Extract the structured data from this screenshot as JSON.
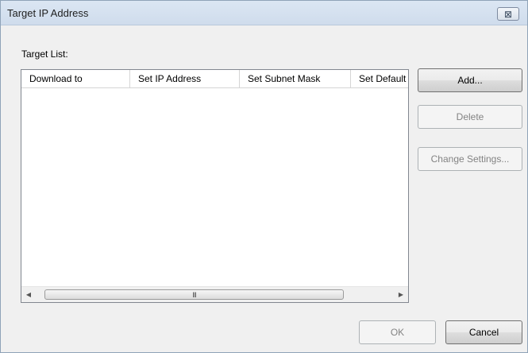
{
  "window": {
    "title": "Target IP Address",
    "close_label": "⊠"
  },
  "target_list": {
    "label": "Target List:",
    "columns": [
      "Download to",
      "Set IP Address",
      "Set Subnet Mask",
      "Set Default Gateway"
    ],
    "rows": []
  },
  "scrollbar": {
    "left_arrow": "◀",
    "right_arrow": "▶",
    "thumb_grip": "III"
  },
  "buttons": {
    "add": "Add...",
    "delete": "Delete",
    "change_settings": "Change Settings...",
    "ok": "OK",
    "cancel": "Cancel"
  }
}
